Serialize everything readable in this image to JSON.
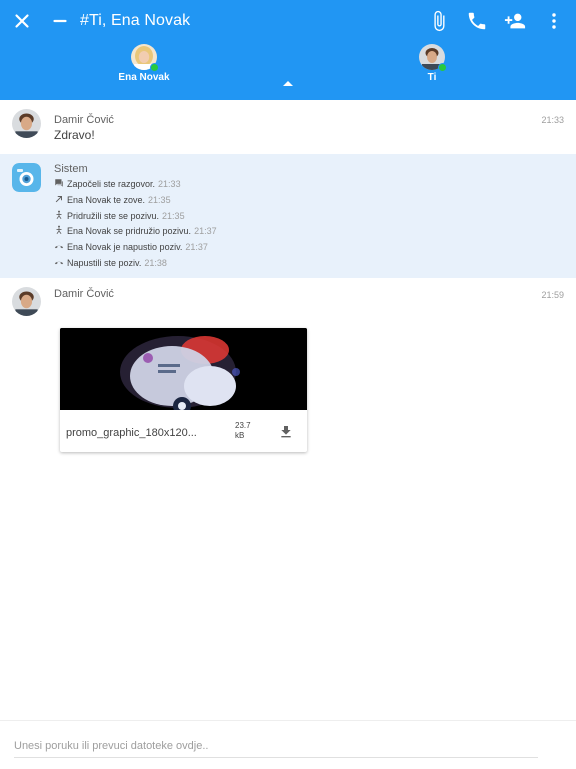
{
  "header": {
    "title": "#Ti, Ena Novak",
    "icons": [
      "close-icon",
      "minimize-icon",
      "attach-icon",
      "phone-icon",
      "add-person-icon",
      "more-vert-icon"
    ]
  },
  "participants": [
    {
      "name": "Ena Novak",
      "status": "online"
    },
    {
      "name": "Ti",
      "status": "online"
    }
  ],
  "messages": [
    {
      "sender": "Damir Čović",
      "time": "21:33",
      "text": "Zdravo!"
    },
    {
      "sender": "Sistem",
      "events": [
        {
          "icon": "chat-icon",
          "text": "Započeli ste razgovor.",
          "time": "21:33"
        },
        {
          "icon": "outgoing-call-icon",
          "text": "Ena Novak te zove.",
          "time": "21:35"
        },
        {
          "icon": "join-call-icon",
          "text": "Pridružili ste se pozivu.",
          "time": "21:35"
        },
        {
          "icon": "join-call-icon",
          "text": "Ena Novak se pridružio pozivu.",
          "time": "21:37"
        },
        {
          "icon": "hangup-icon",
          "text": "Ena Novak je napustio poziv.",
          "time": "21:37"
        },
        {
          "icon": "hangup-icon",
          "text": "Napustili ste poziv.",
          "time": "21:38"
        }
      ]
    },
    {
      "sender": "Damir Čović",
      "time": "21:59",
      "attachment": {
        "filename": "promo_graphic_180x120...",
        "size_value": "23.7",
        "size_unit": "kB"
      }
    }
  ],
  "composer": {
    "placeholder": "Unesi poruku ili prevuci datoteke ovdje.."
  },
  "colors": {
    "primary": "#2196f3",
    "system_bg": "#e8f1fb",
    "online": "#27c93f"
  }
}
